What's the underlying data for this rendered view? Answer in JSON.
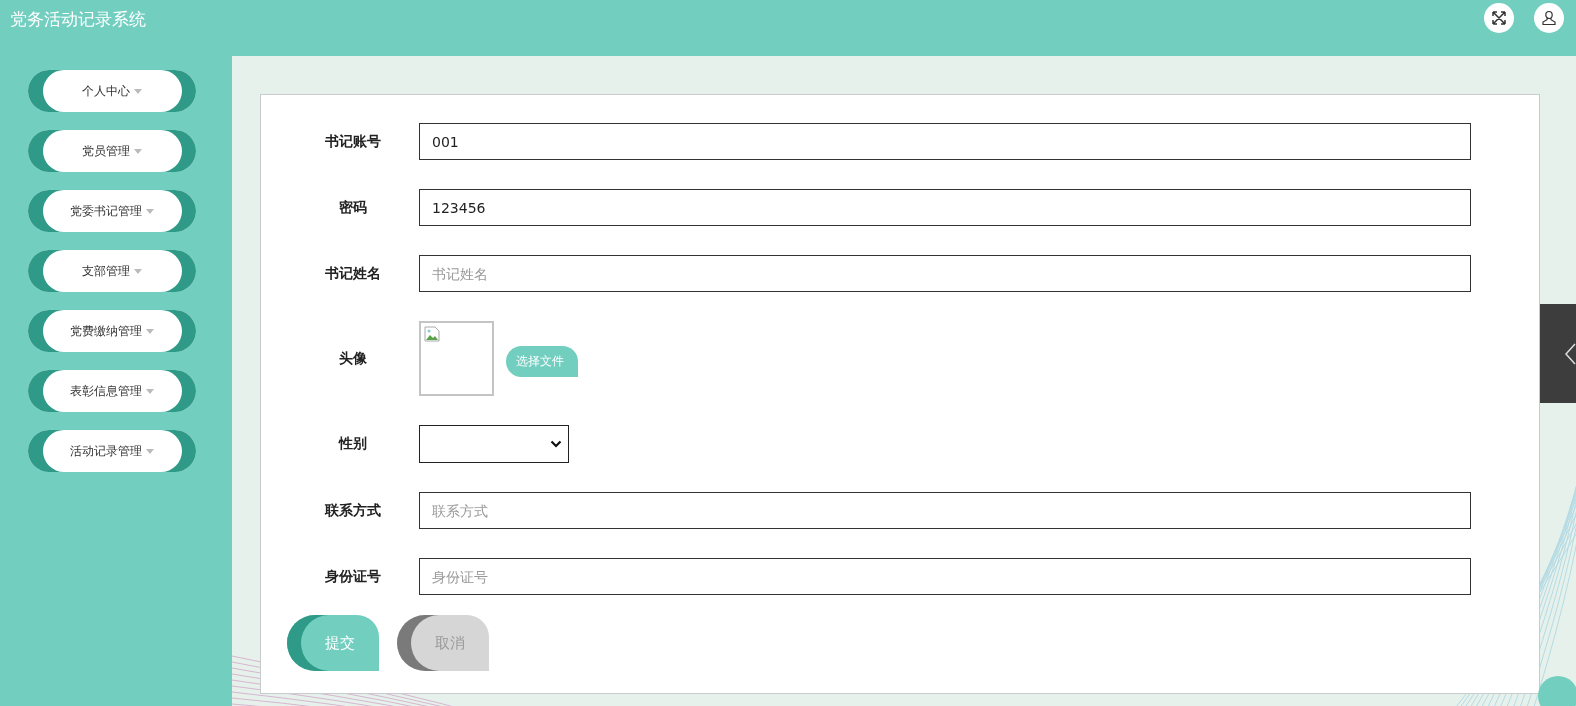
{
  "header": {
    "title": "党务活动记录系统"
  },
  "sidebar": {
    "items": [
      {
        "label": "个人中心"
      },
      {
        "label": "党员管理"
      },
      {
        "label": "党委书记管理"
      },
      {
        "label": "支部管理"
      },
      {
        "label": "党费缴纳管理"
      },
      {
        "label": "表彰信息管理"
      },
      {
        "label": "活动记录管理"
      }
    ]
  },
  "form": {
    "fields": [
      {
        "kind": "text",
        "label": "书记账号",
        "value": "001"
      },
      {
        "kind": "text",
        "label": "密码",
        "value": "123456"
      },
      {
        "kind": "text",
        "label": "书记姓名",
        "placeholder": "书记姓名"
      },
      {
        "kind": "image",
        "label": "头像",
        "button": "选择文件"
      },
      {
        "kind": "select",
        "label": "性别"
      },
      {
        "kind": "text",
        "label": "联系方式",
        "placeholder": "联系方式"
      },
      {
        "kind": "text",
        "label": "身份证号",
        "placeholder": "身份证号"
      }
    ],
    "buttons": [
      {
        "kind": "primary",
        "label": "提交"
      },
      {
        "kind": "secondary",
        "label": "取消"
      }
    ]
  }
}
